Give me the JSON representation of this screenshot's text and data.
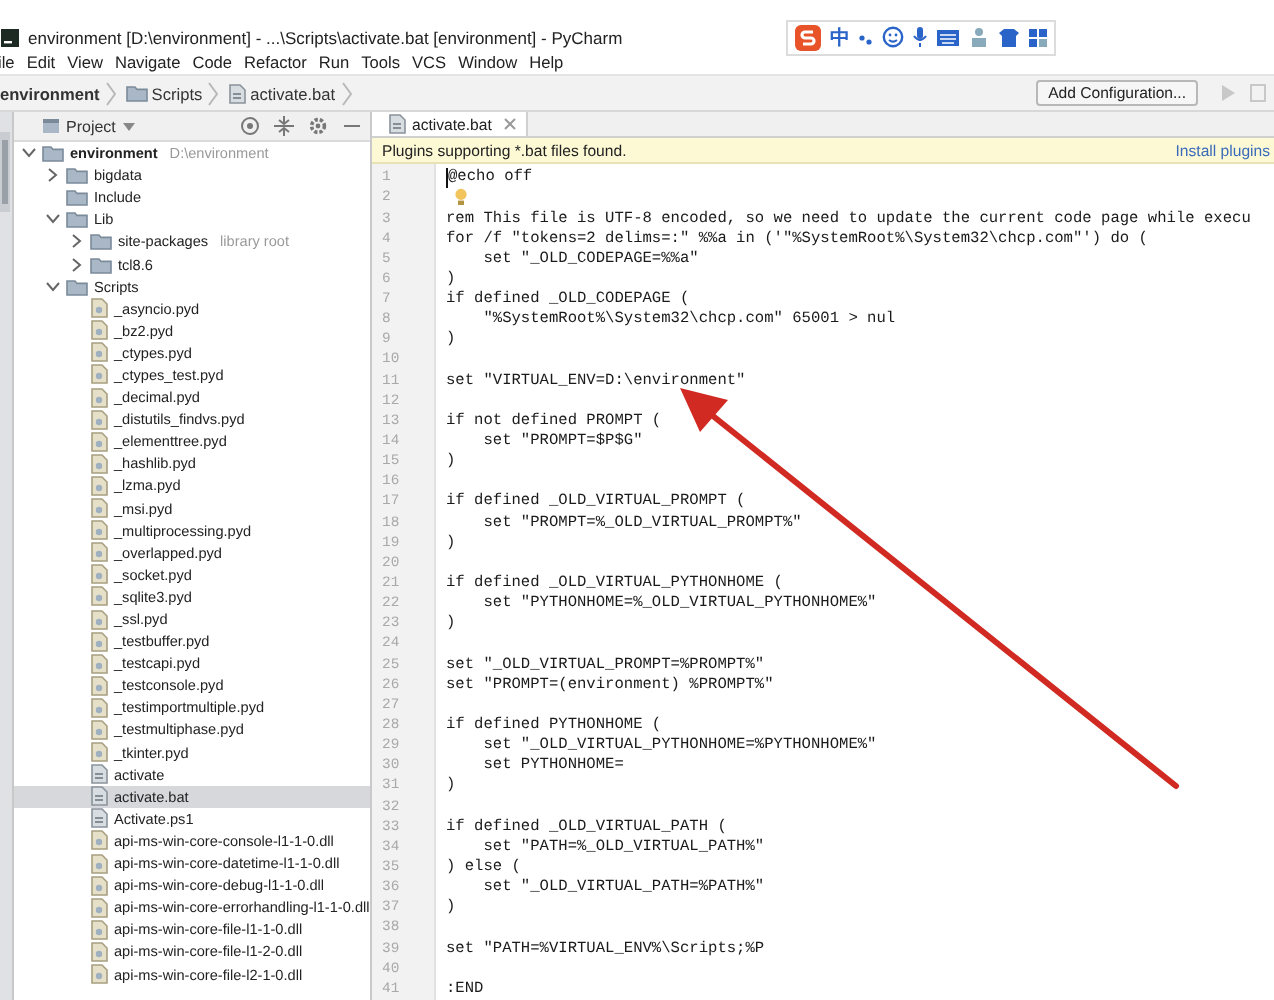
{
  "window": {
    "title": "environment [D:\\environment] - ...\\Scripts\\activate.bat [environment] - PyCharm"
  },
  "ime_toolbar": {
    "label": "中"
  },
  "menu": [
    "ile",
    "Edit",
    "View",
    "Navigate",
    "Code",
    "Refactor",
    "Run",
    "Tools",
    "VCS",
    "Window",
    "Help"
  ],
  "breadcrumbs": [
    {
      "label": "environment",
      "kind": "project"
    },
    {
      "label": "Scripts",
      "kind": "folder"
    },
    {
      "label": "activate.bat",
      "kind": "file"
    }
  ],
  "run_config": {
    "label": "Add Configuration..."
  },
  "project_panel": {
    "title": "Project",
    "tree": [
      {
        "label": "environment",
        "hint": "D:\\environment",
        "kind": "root",
        "expanded": true,
        "selected": false,
        "children": [
          {
            "label": "bigdata",
            "kind": "folder",
            "expanded": false,
            "selected": false
          },
          {
            "label": "Include",
            "kind": "folder",
            "selected": false
          },
          {
            "label": "Lib",
            "kind": "folder",
            "expanded": true,
            "selected": false,
            "children": [
              {
                "label": "site-packages",
                "hint": "library root",
                "kind": "folder",
                "expanded": false,
                "selected": false
              },
              {
                "label": "tcl8.6",
                "kind": "folder",
                "expanded": false,
                "selected": false
              }
            ]
          },
          {
            "label": "Scripts",
            "kind": "folder",
            "expanded": true,
            "selected": false,
            "children": [
              {
                "label": "_asyncio.pyd",
                "kind": "binary",
                "selected": false
              },
              {
                "label": "_bz2.pyd",
                "kind": "binary",
                "selected": false
              },
              {
                "label": "_ctypes.pyd",
                "kind": "binary",
                "selected": false
              },
              {
                "label": "_ctypes_test.pyd",
                "kind": "binary",
                "selected": false
              },
              {
                "label": "_decimal.pyd",
                "kind": "binary",
                "selected": false
              },
              {
                "label": "_distutils_findvs.pyd",
                "kind": "binary",
                "selected": false
              },
              {
                "label": "_elementtree.pyd",
                "kind": "binary",
                "selected": false
              },
              {
                "label": "_hashlib.pyd",
                "kind": "binary",
                "selected": false
              },
              {
                "label": "_lzma.pyd",
                "kind": "binary",
                "selected": false
              },
              {
                "label": "_msi.pyd",
                "kind": "binary",
                "selected": false
              },
              {
                "label": "_multiprocessing.pyd",
                "kind": "binary",
                "selected": false
              },
              {
                "label": "_overlapped.pyd",
                "kind": "binary",
                "selected": false
              },
              {
                "label": "_socket.pyd",
                "kind": "binary",
                "selected": false
              },
              {
                "label": "_sqlite3.pyd",
                "kind": "binary",
                "selected": false
              },
              {
                "label": "_ssl.pyd",
                "kind": "binary",
                "selected": false
              },
              {
                "label": "_testbuffer.pyd",
                "kind": "binary",
                "selected": false
              },
              {
                "label": "_testcapi.pyd",
                "kind": "binary",
                "selected": false
              },
              {
                "label": "_testconsole.pyd",
                "kind": "binary",
                "selected": false
              },
              {
                "label": "_testimportmultiple.pyd",
                "kind": "binary",
                "selected": false
              },
              {
                "label": "_testmultiphase.pyd",
                "kind": "binary",
                "selected": false
              },
              {
                "label": "_tkinter.pyd",
                "kind": "binary",
                "selected": false
              },
              {
                "label": "activate",
                "kind": "script",
                "selected": false
              },
              {
                "label": "activate.bat",
                "kind": "script",
                "selected": true
              },
              {
                "label": "Activate.ps1",
                "kind": "script",
                "selected": false
              },
              {
                "label": "api-ms-win-core-console-l1-1-0.dll",
                "kind": "binary",
                "selected": false
              },
              {
                "label": "api-ms-win-core-datetime-l1-1-0.dll",
                "kind": "binary",
                "selected": false
              },
              {
                "label": "api-ms-win-core-debug-l1-1-0.dll",
                "kind": "binary",
                "selected": false
              },
              {
                "label": "api-ms-win-core-errorhandling-l1-1-0.dll",
                "kind": "binary",
                "selected": false
              },
              {
                "label": "api-ms-win-core-file-l1-1-0.dll",
                "kind": "binary",
                "selected": false
              },
              {
                "label": "api-ms-win-core-file-l1-2-0.dll",
                "kind": "binary",
                "selected": false
              },
              {
                "label": "api-ms-win-core-file-l2-1-0.dll",
                "kind": "binary",
                "selected": false
              }
            ]
          }
        ]
      }
    ]
  },
  "editor": {
    "tabs": [
      {
        "label": "activate.bat",
        "selected": true
      }
    ],
    "banner": {
      "message": "Plugins supporting *.bat files found.",
      "action": "Install plugins"
    },
    "lines": [
      {
        "number": "1",
        "text": "@echo off"
      },
      {
        "number": "2"
      },
      {
        "number": "3",
        "text": "rem This file is UTF-8 encoded, so we need to update the current code page while execu"
      },
      {
        "number": "4",
        "text": "for /f \"tokens=2 delims=:\" %%a in ('\"%SystemRoot%\\System32\\chcp.com\"') do ("
      },
      {
        "number": "5",
        "text": "    set \"_OLD_CODEPAGE=%%a\""
      },
      {
        "number": "6",
        "text": ")"
      },
      {
        "number": "7",
        "text": "if defined _OLD_CODEPAGE ("
      },
      {
        "number": "8",
        "text": "    \"%SystemRoot%\\System32\\chcp.com\" 65001 > nul"
      },
      {
        "number": "9",
        "text": ")"
      },
      {
        "number": "10"
      },
      {
        "number": "11",
        "text": "set \"VIRTUAL_ENV=D:\\environment\""
      },
      {
        "number": "12"
      },
      {
        "number": "13",
        "text": "if not defined PROMPT ("
      },
      {
        "number": "14",
        "text": "    set \"PROMPT=$P$G\""
      },
      {
        "number": "15",
        "text": ")"
      },
      {
        "number": "16"
      },
      {
        "number": "17",
        "text": "if defined _OLD_VIRTUAL_PROMPT ("
      },
      {
        "number": "18",
        "text": "    set \"PROMPT=%_OLD_VIRTUAL_PROMPT%\""
      },
      {
        "number": "19",
        "text": ")"
      },
      {
        "number": "20"
      },
      {
        "number": "21",
        "text": "if defined _OLD_VIRTUAL_PYTHONHOME ("
      },
      {
        "number": "22",
        "text": "    set \"PYTHONHOME=%_OLD_VIRTUAL_PYTHONHOME%\""
      },
      {
        "number": "23",
        "text": ")"
      },
      {
        "number": "24"
      },
      {
        "number": "25",
        "text": "set \"_OLD_VIRTUAL_PROMPT=%PROMPT%\""
      },
      {
        "number": "26",
        "text": "set \"PROMPT=(environment) %PROMPT%\""
      },
      {
        "number": "27"
      },
      {
        "number": "28",
        "text": "if defined PYTHONHOME ("
      },
      {
        "number": "29",
        "text": "    set \"_OLD_VIRTUAL_PYTHONHOME=%PYTHONHOME%\""
      },
      {
        "number": "30",
        "text": "    set PYTHONHOME="
      },
      {
        "number": "31",
        "text": ")"
      },
      {
        "number": "32"
      },
      {
        "number": "33",
        "text": "if defined _OLD_VIRTUAL_PATH ("
      },
      {
        "number": "34",
        "text": "    set \"PATH=%_OLD_VIRTUAL_PATH%\""
      },
      {
        "number": "35",
        "text": ") else ("
      },
      {
        "number": "36",
        "text": "    set \"_OLD_VIRTUAL_PATH=%PATH%\""
      },
      {
        "number": "37",
        "text": ")"
      },
      {
        "number": "38"
      },
      {
        "number": "39",
        "text": "set \"PATH=%VIRTUAL_ENV%\\Scripts;%P"
      },
      {
        "number": "40"
      },
      {
        "number": "41",
        "text": ":END"
      }
    ],
    "intention_bulb": true
  },
  "annotation_arrow": true
}
